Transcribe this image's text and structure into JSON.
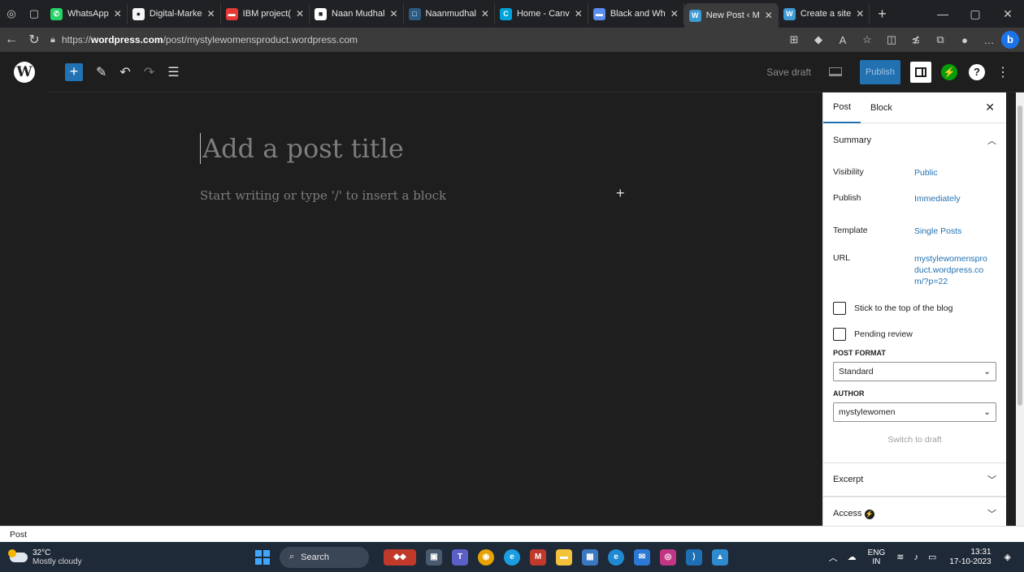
{
  "browser": {
    "tabs": [
      {
        "label": "WhatsApp",
        "icon": "whatsapp-icon",
        "color": "#25d366",
        "glyph": "✆",
        "active": false
      },
      {
        "label": "Digital-Marke",
        "icon": "github-icon",
        "color": "#f5f5f5",
        "glyph": "●",
        "active": false
      },
      {
        "label": "IBM project(",
        "icon": "ibm-icon",
        "color": "#e53935",
        "glyph": "▬",
        "active": false
      },
      {
        "label": "Naan Mudhal",
        "icon": "naan-mudhalvan-icon",
        "color": "#ffffff",
        "glyph": "■",
        "active": false
      },
      {
        "label": "Naanmudhal",
        "icon": "page-icon",
        "color": "#2b5b84",
        "glyph": "□",
        "active": false
      },
      {
        "label": "Home - Canv",
        "icon": "canva-icon",
        "color": "#00a3d9",
        "glyph": "C",
        "active": false
      },
      {
        "label": "Black and Wh",
        "icon": "storage-icon",
        "color": "#5b8def",
        "glyph": "▬",
        "active": false
      },
      {
        "label": "New Post ‹ M",
        "icon": "wordpress-icon",
        "color": "#3e9bd6",
        "glyph": "W",
        "active": true
      },
      {
        "label": "Create a site",
        "icon": "wordpress-icon",
        "color": "#3e9bd6",
        "glyph": "W",
        "active": false
      }
    ],
    "url_prefix": "https://",
    "url_host": "wordpress.com",
    "url_path": "/post/mystylewomensproduct.wordpress.com"
  },
  "toolbar": {
    "save_draft": "Save draft",
    "publish": "Publish",
    "help": "?",
    "more": "⋮"
  },
  "editor": {
    "title_placeholder": "Add a post title",
    "body_placeholder": "Start writing or type '/' to insert a block"
  },
  "sidebar": {
    "tab_post": "Post",
    "tab_block": "Block",
    "summary_title": "Summary",
    "rows": [
      {
        "label": "Visibility",
        "value": "Public"
      },
      {
        "label": "Publish",
        "value": "Immediately"
      },
      {
        "label": "Template",
        "value": "Single Posts"
      },
      {
        "label": "URL",
        "value": "mystylewomenspro duct.wordpress.co m/?p=22"
      }
    ],
    "stick_label": "Stick to the top of the blog",
    "pending_label": "Pending review",
    "post_format_caption": "POST FORMAT",
    "post_format_value": "Standard",
    "author_caption": "AUTHOR",
    "author_value": "mystylewomen",
    "switch_to_draft": "Switch to draft",
    "excerpt_title": "Excerpt",
    "access_title": "Access"
  },
  "footer": {
    "breadcrumb": "Post"
  },
  "taskbar": {
    "temperature": "32°C",
    "weather": "Mostly cloudy",
    "search": "Search",
    "lang_top": "ENG",
    "lang_bottom": "IN",
    "time": "13:31",
    "date": "17-10-2023"
  },
  "colors": {
    "accent": "#2271b1",
    "editor_bg": "#1e1e1e",
    "jetpack": "#069e08"
  }
}
